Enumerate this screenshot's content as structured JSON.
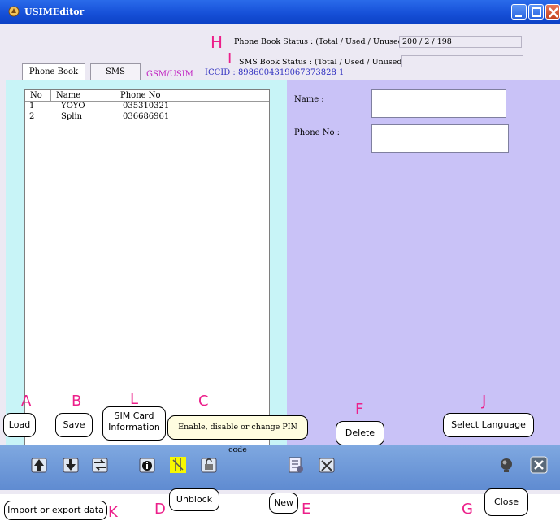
{
  "window": {
    "title": "USIMEditor"
  },
  "status": {
    "phone_book_label": "Phone Book Status : (Total / Used / Unused)",
    "phone_book_value": "200 / 2 / 198",
    "sms_book_label": "SMS Book Status : (Total / Used / Unused)",
    "sms_book_value": "",
    "iccid": "ICCID : 8986004319067373828 1"
  },
  "tabs": [
    {
      "label": "Phone Book"
    },
    {
      "label": "SMS"
    }
  ],
  "card_type": "GSM/USIM",
  "table": {
    "columns": [
      "No",
      "Name",
      "Phone No"
    ],
    "rows": [
      {
        "no": "1",
        "name": "YOYO",
        "phone": "035310321"
      },
      {
        "no": "2",
        "name": "Splin",
        "phone": "036686961"
      }
    ]
  },
  "form": {
    "name_label": "Name :",
    "phone_label": "Phone No :",
    "name_value": "",
    "phone_value": ""
  },
  "annotations": {
    "H": "H",
    "I": "I",
    "A": "A",
    "B": "B",
    "L": "L",
    "C": "C",
    "F": "F",
    "J": "J",
    "D": "D",
    "E": "E",
    "G": "G",
    "K": "K"
  },
  "callouts": {
    "load": "Load",
    "save": "Save",
    "sim_info": "SIM Card Information",
    "pin": "Enable, disable or change PIN code",
    "delete": "Delete",
    "language": "Select Language",
    "import_export": "Import or export data",
    "unblock": "Unblock",
    "new": "New",
    "close": "Close"
  },
  "colors": {
    "list_bg": "#c8f4f7",
    "form_bg": "#c9c2f7",
    "annot": "#ec1f8a",
    "card_type": "#c020c0",
    "iccid": "#3030c0"
  }
}
